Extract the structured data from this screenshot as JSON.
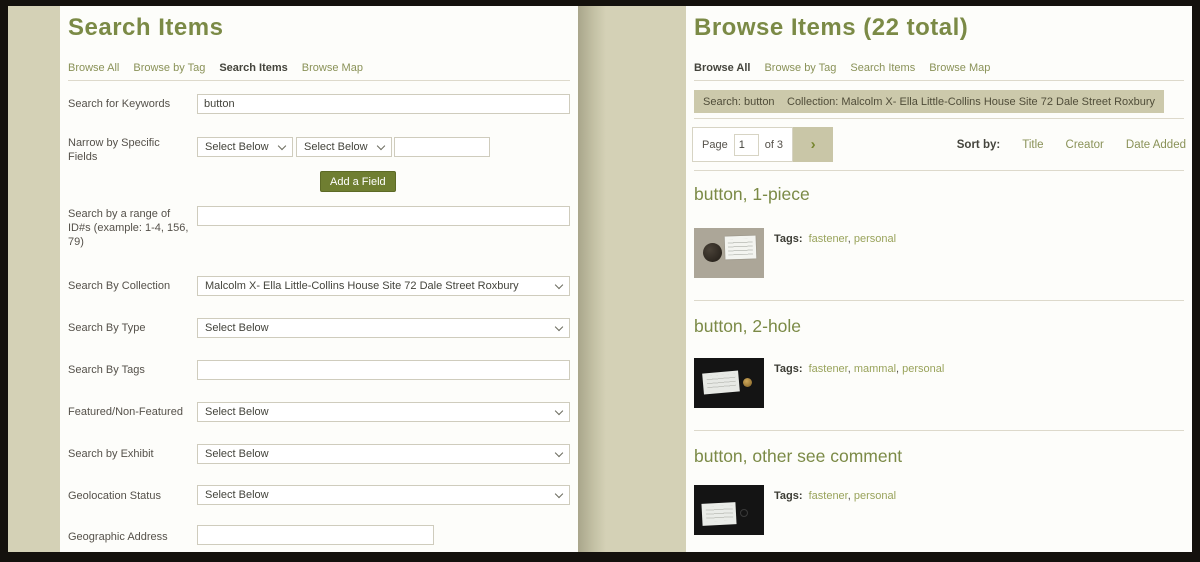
{
  "theme": {
    "background_khaki": "#d4d1b6",
    "page_white": "#fdfdfa",
    "heading_olive": "#7b8a46",
    "link_olive": "#8a9258",
    "tag_olive": "#99a35b",
    "button_olive": "#6f7e31",
    "chip_khaki": "#ccc9ab",
    "frame_black": "#14110d"
  },
  "left_page": {
    "title": "Search Items",
    "nav": [
      {
        "label": "Browse All",
        "active": false
      },
      {
        "label": "Browse by Tag",
        "active": false
      },
      {
        "label": "Search Items",
        "active": true
      },
      {
        "label": "Browse Map",
        "active": false
      }
    ],
    "form": {
      "keywords": {
        "label": "Search for Keywords",
        "value": "button"
      },
      "narrow": {
        "label": "Narrow by Specific Fields",
        "select1": "Select Below",
        "select2": "Select Below",
        "input_value": ""
      },
      "add_field_button": "Add a Field",
      "id_range": {
        "label": "Search by a range of ID#s (example: 1-4, 156, 79)",
        "value": ""
      },
      "collection": {
        "label": "Search By Collection",
        "value": "Malcolm X- Ella Little-Collins House Site 72 Dale Street Roxbury"
      },
      "type": {
        "label": "Search By Type",
        "value": "Select Below"
      },
      "tags": {
        "label": "Search By Tags",
        "value": ""
      },
      "featured": {
        "label": "Featured/Non-Featured",
        "value": "Select Below"
      },
      "exhibit": {
        "label": "Search by Exhibit",
        "value": "Select Below"
      },
      "geolocation": {
        "label": "Geolocation Status",
        "value": "Select Below"
      },
      "address": {
        "label": "Geographic Address",
        "value": ""
      }
    }
  },
  "right_page": {
    "title": "Browse Items (22 total)",
    "nav": [
      {
        "label": "Browse All",
        "active": true
      },
      {
        "label": "Browse by Tag",
        "active": false
      },
      {
        "label": "Search Items",
        "active": false
      },
      {
        "label": "Browse Map",
        "active": false
      }
    ],
    "filters": [
      {
        "label": "Search: button"
      },
      {
        "label": "Collection: Malcolm X- Ella Little-Collins House Site 72 Dale Street Roxbury"
      }
    ],
    "pagination": {
      "page_label": "Page",
      "current_page": "1",
      "of_label": "of 3",
      "next_label": "›"
    },
    "sort": {
      "label": "Sort by:",
      "options": [
        "Title",
        "Creator",
        "Date Added"
      ]
    },
    "items": [
      {
        "title": "button, 1-piece",
        "tags_label": "Tags:",
        "tags": [
          "fastener",
          "personal"
        ]
      },
      {
        "title": "button, 2-hole",
        "tags_label": "Tags:",
        "tags": [
          "fastener",
          "mammal",
          "personal"
        ]
      },
      {
        "title": "button, other see comment",
        "tags_label": "Tags:",
        "tags": [
          "fastener",
          "personal"
        ]
      }
    ]
  }
}
